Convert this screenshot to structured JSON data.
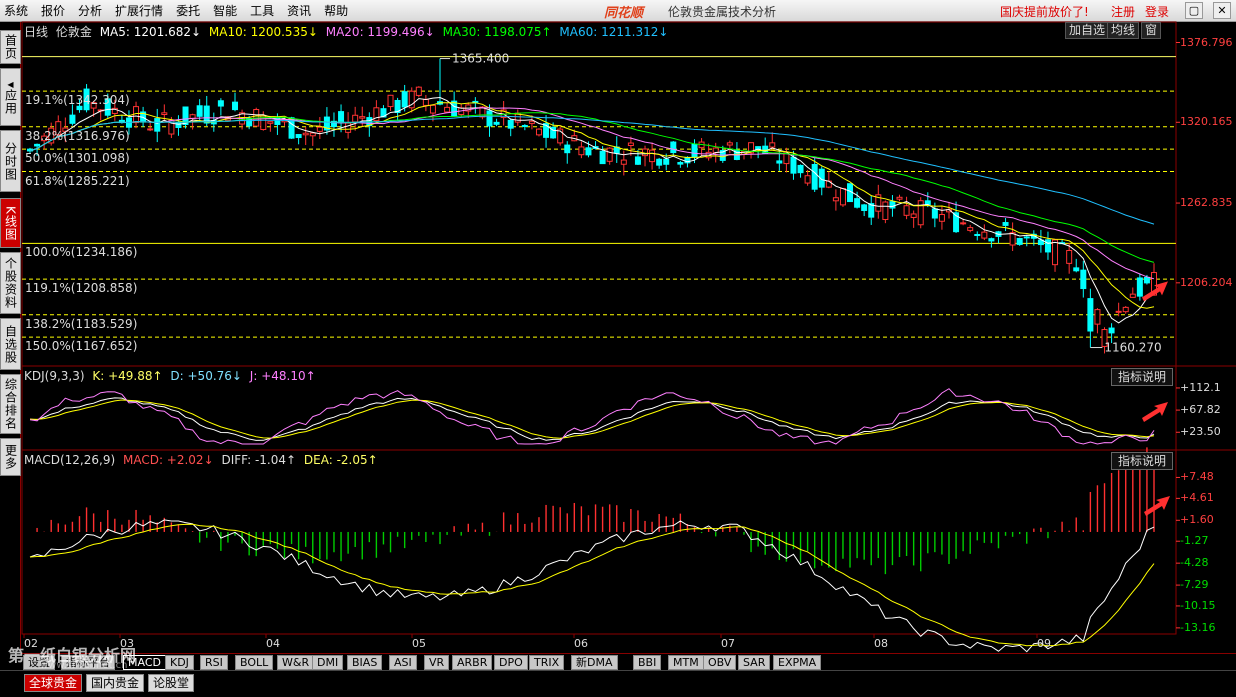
{
  "menubar": {
    "items": [
      "系统",
      "报价",
      "分析",
      "扩展行情",
      "委托",
      "智能",
      "工具",
      "资讯",
      "帮助"
    ],
    "brand": "同花顺",
    "app_title": "伦敦贵金属技术分析",
    "promo": "国庆提前放价了!",
    "register": "注册",
    "login": "登录"
  },
  "sidebar": {
    "tabs": [
      {
        "label": "首页"
      },
      {
        "label": "应用"
      },
      {
        "label": "分时图"
      },
      {
        "label": "K线图"
      },
      {
        "label": "个股资料"
      },
      {
        "label": "自选股"
      },
      {
        "label": "综合排名"
      },
      {
        "label": "更多"
      }
    ]
  },
  "main_header": {
    "period": "日线",
    "symbol": "伦敦金",
    "ma5": "MA5: 1201.682↓",
    "ma10": "MA10: 1200.535↓",
    "ma20": "MA20: 1199.496↓",
    "ma30": "MA30: 1198.075↑",
    "ma60": "MA60: 1211.312↓",
    "add_watch": "加自选",
    "avg_line": "均线",
    "window_btn": "窗"
  },
  "fibonacci": [
    {
      "label": "19.1%(1342.304)",
      "value": 1342.304
    },
    {
      "label": "38.2%(1316.976)",
      "value": 1316.976
    },
    {
      "label": "50.0%(1301.098)",
      "value": 1301.098
    },
    {
      "label": "61.8%(1285.221)",
      "value": 1285.221
    },
    {
      "label": "100.0%(1234.186)",
      "value": 1234.186
    },
    {
      "label": "119.1%(1208.858)",
      "value": 1208.858
    },
    {
      "label": "138.2%(1183.529)",
      "value": 1183.529
    },
    {
      "label": "150.0%(1167.652)",
      "value": 1167.652
    }
  ],
  "annotations": {
    "high": "1365.400",
    "low": "1160.270"
  },
  "price_axis": [
    "1376.796",
    "1320.165",
    "1262.835",
    "1206.204"
  ],
  "kdj": {
    "title": "KDJ(9,3,3)",
    "k": "K: +49.88↑",
    "d": "D: +50.76↓",
    "j": "J: +48.10↑",
    "button": "指标说明",
    "axis": [
      "+112.1",
      "+67.82",
      "+23.50"
    ]
  },
  "macd": {
    "title": "MACD(12,26,9)",
    "macd": "MACD: +2.02↓",
    "diff": "DIFF: -1.04↑",
    "dea": "DEA: -2.05↑",
    "button": "指标说明",
    "axis": [
      "+7.48",
      "+4.61",
      "+1.60",
      "-1.27",
      "-4.28",
      "-7.29",
      "-10.15",
      "-13.16"
    ]
  },
  "x_axis": [
    "02",
    "03",
    "04",
    "05",
    "06",
    "07",
    "08",
    "09"
  ],
  "indicator_tabs": [
    "设置",
    "指标平台",
    "MACD",
    "KDJ",
    "RSI",
    "BOLL",
    "W&R",
    "DMI",
    "BIAS",
    "ASI",
    "VR",
    "ARBR",
    "DPO",
    "TRIX",
    "新DMA",
    "BBI",
    "MTM",
    "OBV",
    "SAR",
    "EXPMA"
  ],
  "bottom_tabs": [
    "全球贵金",
    "国内贵金",
    "论股堂"
  ],
  "watermark": "第一纸白银分析网",
  "watermark_url": "www.silver.net.cn",
  "colors": {
    "up": "#ff3333",
    "down": "#00ffff",
    "ma5": "#ffffff",
    "ma10": "#ffff00",
    "ma20": "#ff80ff",
    "ma30": "#00ff00",
    "ma60": "#20c0ff",
    "fib_solid": "#ffff66",
    "fib_dash": "#ffff00",
    "axis": "#ff3333"
  },
  "chart_data": [
    {
      "type": "candlestick",
      "title": "伦敦金 日线",
      "x": [
        "02",
        "03",
        "04",
        "05",
        "06",
        "07",
        "08",
        "09"
      ],
      "ylim": [
        1150,
        1380
      ],
      "high": 1365.4,
      "low": 1160.27,
      "ma": {
        "MA5": 1201.682,
        "MA10": 1200.535,
        "MA20": 1199.496,
        "MA30": 1198.075,
        "MA60": 1211.312
      },
      "closes_by_month": [
        1330,
        1318,
        1325,
        1300,
        1305,
        1270,
        1235,
        1205,
        1205
      ]
    },
    {
      "type": "line",
      "title": "KDJ(9,3,3)",
      "ylim": [
        23.5,
        112.1
      ],
      "series": [
        {
          "name": "K",
          "last": 49.88
        },
        {
          "name": "D",
          "last": 50.76
        },
        {
          "name": "J",
          "last": 48.1
        }
      ]
    },
    {
      "type": "bar",
      "title": "MACD(12,26,9)",
      "ylim": [
        -13.16,
        7.48
      ],
      "series": [
        {
          "name": "MACD",
          "last": 2.02
        },
        {
          "name": "DIFF",
          "last": -1.04
        },
        {
          "name": "DEA",
          "last": -2.05
        }
      ]
    }
  ]
}
